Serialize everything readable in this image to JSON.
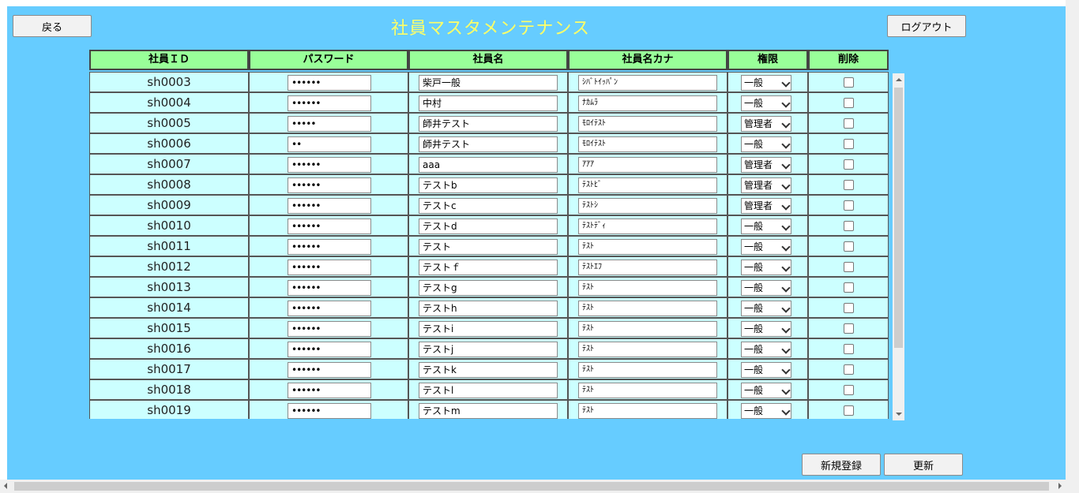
{
  "header": {
    "back_label": "戻る",
    "title": "社員マスタメンテナンス",
    "logout_label": "ログアウト"
  },
  "columns": [
    "社員ＩＤ",
    "パスワード",
    "社員名",
    "社員名カナ",
    "権限",
    "削除"
  ],
  "rows": [
    {
      "id": "sh0003",
      "password": "••••••",
      "name": "柴戸一般",
      "kana": "ｼﾊﾞﾄｲｯﾊﾟﾝ",
      "role": "一般"
    },
    {
      "id": "sh0004",
      "password": "••••••",
      "name": "中村",
      "kana": "ﾅｶﾑﾗ",
      "role": "一般"
    },
    {
      "id": "sh0005",
      "password": "•••••",
      "name": "師井テスト",
      "kana": "ﾓﾛｲﾃｽﾄ",
      "role": "管理者"
    },
    {
      "id": "sh0006",
      "password": "••",
      "name": "師井テスト",
      "kana": "ﾓﾛｲﾃｽﾄ",
      "role": "一般"
    },
    {
      "id": "sh0007",
      "password": "••••••",
      "name": "aaa",
      "kana": "ｱｱｱ",
      "role": "管理者"
    },
    {
      "id": "sh0008",
      "password": "••••••",
      "name": "テストb",
      "kana": "ﾃｽﾄﾋﾞ",
      "role": "管理者"
    },
    {
      "id": "sh0009",
      "password": "••••••",
      "name": "テストc",
      "kana": "ﾃｽﾄｼ",
      "role": "管理者"
    },
    {
      "id": "sh0010",
      "password": "••••••",
      "name": "テストd",
      "kana": "ﾃｽﾄﾃﾞｨ",
      "role": "一般"
    },
    {
      "id": "sh0011",
      "password": "••••••",
      "name": "テスト",
      "kana": "ﾃｽﾄ",
      "role": "一般"
    },
    {
      "id": "sh0012",
      "password": "••••••",
      "name": "テストｆ",
      "kana": "ﾃｽﾄｴﾌ",
      "role": "一般"
    },
    {
      "id": "sh0013",
      "password": "••••••",
      "name": "テストg",
      "kana": "ﾃｽﾄ",
      "role": "一般"
    },
    {
      "id": "sh0014",
      "password": "••••••",
      "name": "テストh",
      "kana": "ﾃｽﾄ",
      "role": "一般"
    },
    {
      "id": "sh0015",
      "password": "••••••",
      "name": "テストi",
      "kana": "ﾃｽﾄ",
      "role": "一般"
    },
    {
      "id": "sh0016",
      "password": "••••••",
      "name": "テストj",
      "kana": "ﾃｽﾄ",
      "role": "一般"
    },
    {
      "id": "sh0017",
      "password": "••••••",
      "name": "テストk",
      "kana": "ﾃｽﾄ",
      "role": "一般"
    },
    {
      "id": "sh0018",
      "password": "••••••",
      "name": "テストl",
      "kana": "ﾃｽﾄ",
      "role": "一般"
    },
    {
      "id": "sh0019",
      "password": "••••••",
      "name": "テストm",
      "kana": "ﾃｽﾄ",
      "role": "一般"
    }
  ],
  "footer": {
    "new_label": "新規登録",
    "update_label": "更新"
  },
  "colors": {
    "background": "#66ccff",
    "title": "#ffff66",
    "header_cell": "#99ff99",
    "row_cell": "#ccffff"
  }
}
